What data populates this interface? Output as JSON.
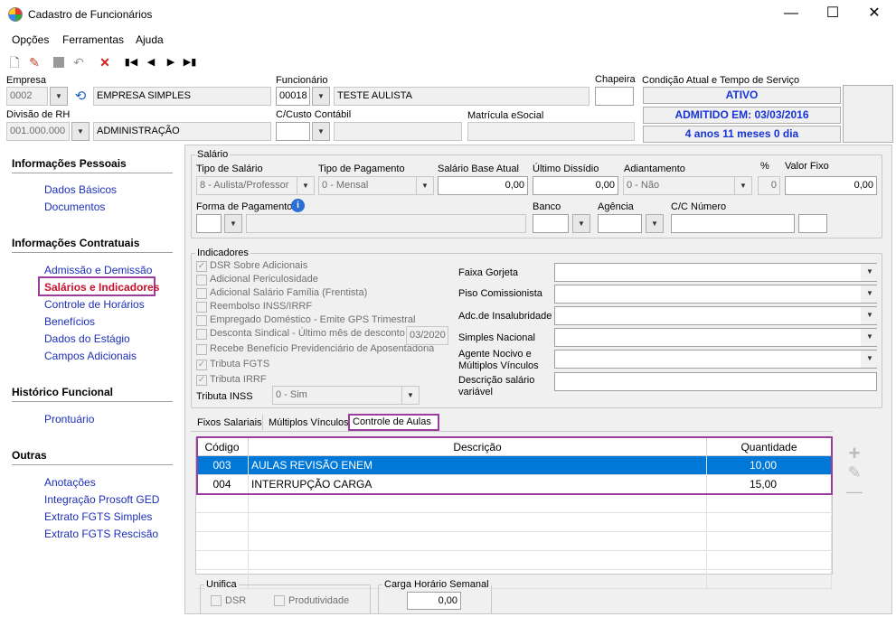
{
  "window": {
    "title": "Cadastro de Funcionários",
    "minimize": "—",
    "maximize": "☐",
    "close": "✕"
  },
  "menu": [
    "Opções",
    "Ferramentas",
    "Ajuda"
  ],
  "toolbar": {
    "icons": [
      "new-document-icon",
      "edit-icon",
      "save-icon",
      "undo-icon",
      "delete-icon",
      "first-record-icon",
      "previous-record-icon",
      "next-record-icon",
      "last-record-icon"
    ]
  },
  "header": {
    "empresa_label": "Empresa",
    "empresa_code": "0002",
    "empresa_name": "EMPRESA SIMPLES",
    "funcionario_label": "Funcionário",
    "funcionario_code": "00018",
    "funcionario_name": "TESTE AULISTA",
    "chapeira_label": "Chapeira",
    "chapeira_value": "",
    "condicao_label": "Condição Atual e Tempo de Serviço",
    "status": "ATIVO",
    "admitido": "ADMITIDO EM: 03/03/2016",
    "tempo": "4 anos 11 meses 0 dia",
    "divisao_label": "Divisão de RH",
    "divisao_code": "001.000.000",
    "divisao_name": "ADMINISTRAÇÃO",
    "custo_label": "C/Custo Contábil",
    "custo_value": "",
    "matricula_label": "Matrícula eSocial",
    "matricula_value": ""
  },
  "sidebar": {
    "sections": [
      {
        "title": "Informações Pessoais",
        "items": [
          "Dados Básicos",
          "Documentos"
        ]
      },
      {
        "title": "Informações Contratuais",
        "items": [
          "Admissão e Demissão",
          "Salários e Indicadores",
          "Controle de Horários",
          "Benefícios",
          "Dados do Estágio",
          "Campos Adicionais"
        ]
      },
      {
        "title": "Histórico Funcional",
        "items": [
          "Prontuário"
        ]
      },
      {
        "title": "Outras",
        "items": [
          "Anotações",
          "Integração Prosoft GED",
          "Extrato FGTS Simples",
          "Extrato FGTS Rescisão"
        ]
      }
    ],
    "active": "Salários e Indicadores"
  },
  "salario": {
    "group_title": "Salário",
    "tipo_label": "Tipo de Salário",
    "tipo_value": "8 - Aulista/Professor",
    "tipo_pag_label": "Tipo de Pagamento",
    "tipo_pag_value": "0 - Mensal",
    "base_label": "Salário Base Atual",
    "base_value": "0,00",
    "dissidio_label": "Último Dissídio",
    "dissidio_value": "0,00",
    "adiant_label": "Adiantamento",
    "adiant_value": "0 - Não",
    "pct_label": "%",
    "pct_value": "0",
    "fixo_label": "Valor Fixo",
    "fixo_value": "0,00",
    "forma_label": "Forma de Pagamento",
    "forma_value": "",
    "banco_label": "Banco",
    "agencia_label": "Agência",
    "cc_label": "C/C Número"
  },
  "indicadores": {
    "group_title": "Indicadores",
    "checks": [
      {
        "label": "DSR Sobre Adicionais",
        "checked": true
      },
      {
        "label": "Adicional Periculosidade",
        "checked": false
      },
      {
        "label": "Adicional Salário Família (Frentista)",
        "checked": false
      },
      {
        "label": "Reembolso INSS/IRRF",
        "checked": false
      },
      {
        "label": "Empregado Doméstico - Emite GPS Trimestral",
        "checked": false
      },
      {
        "label": "Desconta Sindical - Último mês de desconto",
        "checked": false
      },
      {
        "label": "Recebe Benefício Previdenciário de Aposentadoria",
        "checked": false
      },
      {
        "label": "Tributa FGTS",
        "checked": true
      },
      {
        "label": "Tributa IRRF",
        "checked": true
      }
    ],
    "sindical_date": "03/2020",
    "inss_label": "Tributa INSS",
    "inss_value": "0 - Sim",
    "right_labels": [
      "Faixa Gorjeta",
      "Piso Comissionista",
      "Adc.de Insalubridade",
      "Simples Nacional",
      "Agente Nocivo e Múltiplos Vínculos",
      "Descrição salário variável"
    ]
  },
  "tabs": [
    "Fixos Salariais",
    "Múltiplos Vínculos",
    "Controle de Aulas"
  ],
  "active_tab": "Controle de Aulas",
  "aulas_table": {
    "columns": [
      "Código",
      "Descrição",
      "Quantidade"
    ],
    "rows": [
      {
        "codigo": "003",
        "descricao": "AULAS REVISÃO ENEM",
        "quantidade": "10,00"
      },
      {
        "codigo": "004",
        "descricao": "INTERRUPÇÃO CARGA",
        "quantidade": "15,00"
      }
    ]
  },
  "side_buttons": {
    "add": "+",
    "edit": "✎",
    "remove": "—"
  },
  "unifica": {
    "title": "Unifica",
    "dsr": "DSR",
    "produtividade": "Produtividade"
  },
  "carga": {
    "title": "Carga Horário Semanal",
    "value": "0,00"
  },
  "colors": {
    "accent_text": "#1533d8",
    "highlight": "#9a3d9c",
    "selection": "#0078d7",
    "active_link": "#c8102e"
  }
}
